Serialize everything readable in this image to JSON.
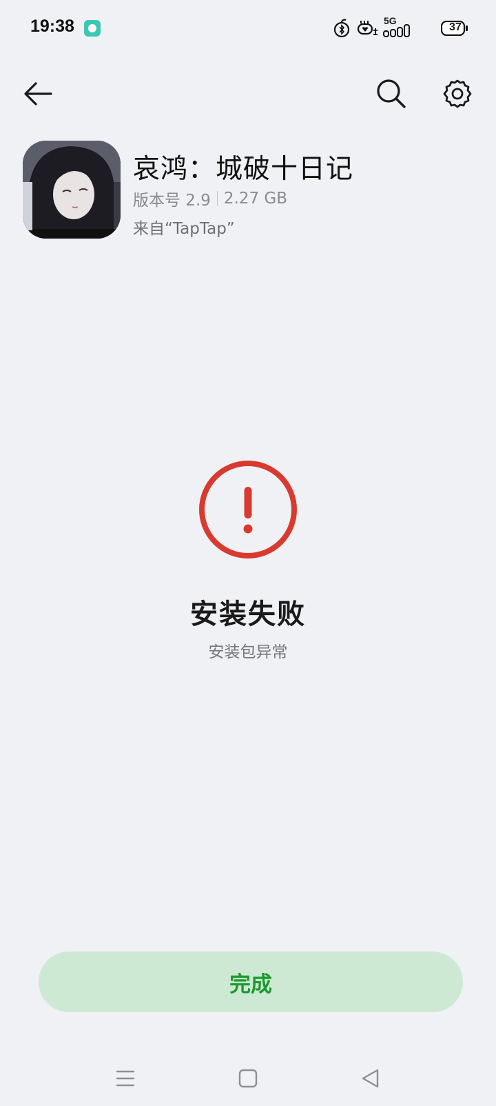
{
  "status_bar": {
    "time": "19:38",
    "network": "5G",
    "battery": "37"
  },
  "app_bar": {
    "back_icon": "arrow-left-icon",
    "search_icon": "search-icon",
    "settings_icon": "gear-icon"
  },
  "app": {
    "name": "哀鸿：城破十日记",
    "version": "版本号 2.9",
    "size": "2.27 GB",
    "source": "来自“TapTap”"
  },
  "result": {
    "icon": "error-circle-icon",
    "title": "安装失败",
    "subtitle": "安装包异常",
    "accent_color": "#d83a2f"
  },
  "actions": {
    "done_label": "完成",
    "done_text_color": "#1b9a2e",
    "done_bg_color": "#cde9d3"
  },
  "nav_bar": {
    "menu_icon": "menu-icon",
    "home_icon": "home-square-icon",
    "back_icon": "back-triangle-icon"
  }
}
